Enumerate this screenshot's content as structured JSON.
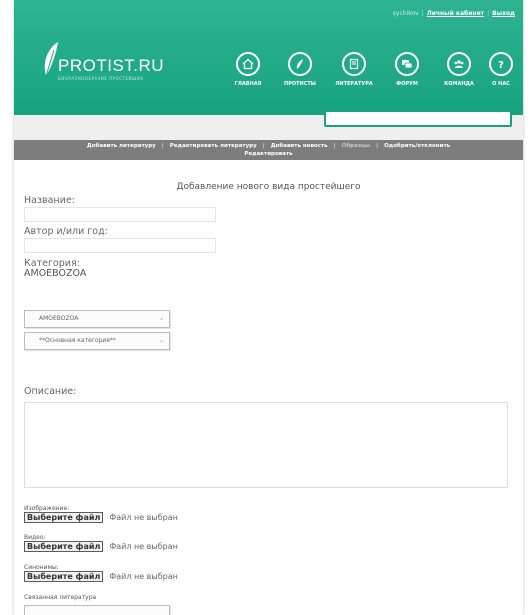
{
  "header": {
    "user": "sychikov",
    "links": [
      "Личный кабинет",
      "Выход"
    ],
    "logo_text": "PROTIST.RU",
    "logo_tagline": "БИОРАЗНООБРАЗИЕ ПРОСТЕЙШИХ",
    "nav": [
      {
        "label": "ГЛАВНАЯ",
        "icon": "home-icon"
      },
      {
        "label": "ПРОТИСТЫ",
        "icon": "leaf-icon"
      },
      {
        "label": "ЛИТЕРАТУРА",
        "icon": "book-icon"
      },
      {
        "label": "ФОРУМ",
        "icon": "chat-icon"
      },
      {
        "label": "КОМАНДА",
        "icon": "team-icon"
      },
      {
        "label": "О НАС",
        "icon": "question-icon"
      }
    ]
  },
  "search": {
    "placeholder": ""
  },
  "submenu": {
    "items": [
      "Добавить литературу",
      "Редактировать литературу",
      "Добавить новость",
      "Образцы",
      "Одобрить/отклонить",
      "Редактировать"
    ]
  },
  "form": {
    "title": "Добавление нового вида простейшего",
    "name_label": "Название:",
    "author_label": "Автор и/или год:",
    "category_label": "Категория:",
    "category_value": "AMOEBOZOA",
    "select1": "AMOEBOZOA",
    "select2": "**Основная категория**",
    "description_label": "Описание:",
    "image_label": "Изображение:",
    "video_label": "Видео:",
    "synonyms_label": "Синонимы:",
    "file_button": "Выберите файл",
    "file_status": "Файл не выбран",
    "related_label": "Связанная литература"
  },
  "colors": {
    "header_green": "#1ea887",
    "submenu_gray": "#7d7d7d"
  }
}
